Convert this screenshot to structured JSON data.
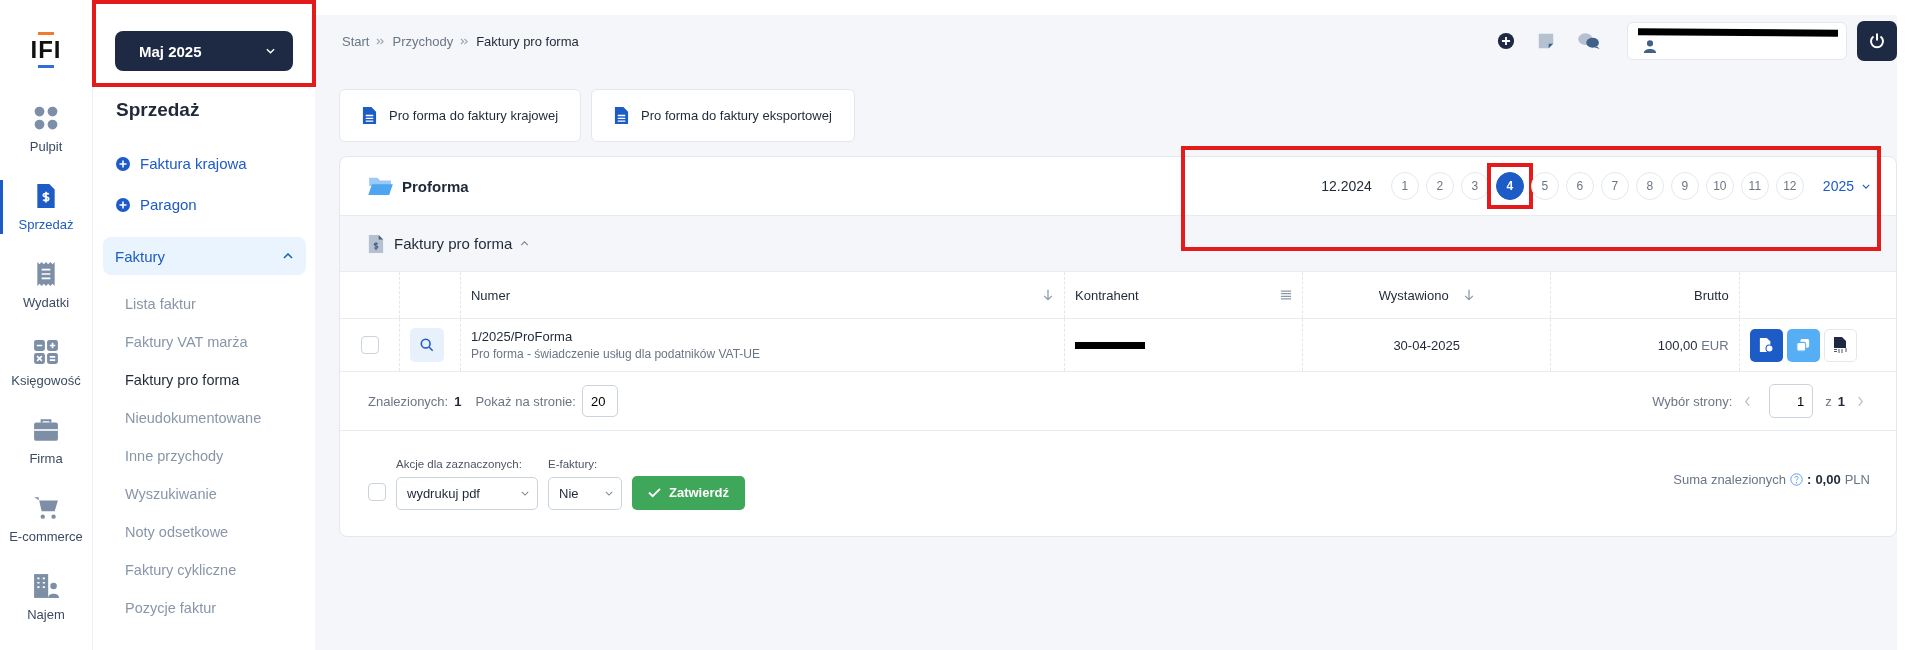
{
  "rail": {
    "logo": "IFI",
    "items": [
      {
        "label": "Pulpit",
        "selected": false
      },
      {
        "label": "Sprzedaż",
        "selected": true
      },
      {
        "label": "Wydatki",
        "selected": false
      },
      {
        "label": "Księgowość",
        "selected": false
      },
      {
        "label": "Firma",
        "selected": false
      },
      {
        "label": "E-commerce",
        "selected": false
      },
      {
        "label": "Najem",
        "selected": false
      }
    ]
  },
  "sidebar": {
    "period": {
      "label": "Maj 2025",
      "highlighted": true
    },
    "title": "Sprzedaż",
    "actions": [
      "Faktura krajowa",
      "Paragon"
    ],
    "group": {
      "label": "Faktury",
      "expanded": true,
      "items": [
        {
          "label": "Lista faktur",
          "selected": false
        },
        {
          "label": "Faktury VAT marża",
          "selected": false
        },
        {
          "label": "Faktury pro forma",
          "selected": true
        },
        {
          "label": "Nieudokumentowane",
          "selected": false
        },
        {
          "label": "Inne przychody",
          "selected": false
        },
        {
          "label": "Wyszukiwanie",
          "selected": false
        },
        {
          "label": "Noty odsetkowe",
          "selected": false
        },
        {
          "label": "Faktury cykliczne",
          "selected": false
        },
        {
          "label": "Pozycje faktur",
          "selected": false
        }
      ]
    }
  },
  "breadcrumb": [
    "Start",
    "Przychody",
    "Faktury pro forma"
  ],
  "user": {
    "redacted": true
  },
  "quick_buttons": [
    "Pro forma do faktury krajowej",
    "Pro forma do faktury eksportowej"
  ],
  "panel": {
    "title": "Proforma",
    "month_picker": {
      "highlighted": true,
      "previous": "12.2024",
      "year": "2025",
      "months": [
        {
          "label": "1",
          "selected": false,
          "highlighted": false
        },
        {
          "label": "2",
          "selected": false,
          "highlighted": false
        },
        {
          "label": "3",
          "selected": false,
          "highlighted": false
        },
        {
          "label": "4",
          "selected": true,
          "highlighted": true
        },
        {
          "label": "5",
          "selected": false,
          "highlighted": false
        },
        {
          "label": "6",
          "selected": false,
          "highlighted": false
        },
        {
          "label": "7",
          "selected": false,
          "highlighted": false
        },
        {
          "label": "8",
          "selected": false,
          "highlighted": false
        },
        {
          "label": "9",
          "selected": false,
          "highlighted": false
        },
        {
          "label": "10",
          "selected": false,
          "highlighted": false
        },
        {
          "label": "11",
          "selected": false,
          "highlighted": false
        },
        {
          "label": "12",
          "selected": false,
          "highlighted": false
        }
      ]
    },
    "section": {
      "title": "Faktury pro forma",
      "expanded": true
    },
    "table": {
      "columns": [
        {
          "label": "Numer",
          "kind": "sortable"
        },
        {
          "label": "Kontrahent",
          "kind": "filterable"
        },
        {
          "label": "Wystawiono",
          "kind": "sortable"
        },
        {
          "label": "Brutto",
          "kind": "plain"
        }
      ],
      "rows": [
        {
          "checked": false,
          "number": "1/2025/ProForma",
          "description": "Pro forma - świadczenie usług dla podatników VAT-UE",
          "contractor_redacted": true,
          "issued": "30-04-2025",
          "amount": "100,00",
          "currency": "EUR"
        }
      ]
    }
  },
  "footer": {
    "found_label": "Znalezionych:",
    "found": "1",
    "per_page_label": "Pokaż na stronie:",
    "per_page": "20",
    "page_label": "Wybór strony:",
    "page": "1",
    "of": "z",
    "pages": "1"
  },
  "bulk": {
    "checked": false,
    "action_label": "Akcje dla zaznaczonych:",
    "action": "wydrukuj pdf",
    "einvoice_label": "E-faktury:",
    "einvoice": "Nie",
    "submit": "Zatwierdź",
    "sum_label": "Suma znalezionych",
    "sum_separator": ":",
    "sum": "0,00",
    "sum_currency": "PLN"
  }
}
